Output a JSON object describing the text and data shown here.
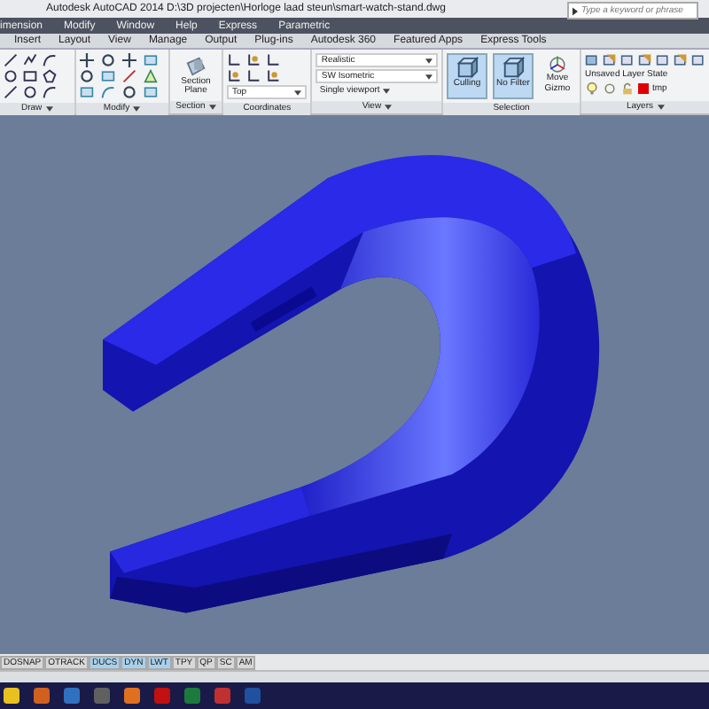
{
  "window": {
    "title": "Autodesk AutoCAD 2014    D:\\3D projecten\\Horloge laad steun\\smart-watch-stand.dwg"
  },
  "search": {
    "placeholder": "Type a keyword or phrase"
  },
  "menu": [
    "imension",
    "Modify",
    "Window",
    "Help",
    "Express",
    "Parametric"
  ],
  "ribbon_tabs": [
    "Insert",
    "Layout",
    "View",
    "Manage",
    "Output",
    "Plug-ins",
    "Autodesk 360",
    "Featured Apps",
    "Express Tools"
  ],
  "panels": {
    "draw": {
      "title": "Draw"
    },
    "modify": {
      "title": "Modify"
    },
    "section": {
      "title": "Section",
      "button": "Section Plane"
    },
    "coordinates": {
      "title": "Coordinates",
      "view_dropdown": "Top"
    },
    "view": {
      "title": "View",
      "visual_style": "Realistic",
      "view_preset": "SW Isometric",
      "viewport": "Single viewport"
    },
    "selection": {
      "title": "Selection",
      "buttons": [
        {
          "label": "Culling",
          "on": true
        },
        {
          "label": "No Filter",
          "on": true
        },
        {
          "label": "Move Gizmo",
          "on": false
        }
      ]
    },
    "layers": {
      "title": "Layers",
      "layer_state": "Unsaved Layer State",
      "layer": {
        "name": "tmp",
        "color": "#e00000"
      }
    }
  },
  "status_toggles": [
    {
      "label": "DOSNAP",
      "on": false
    },
    {
      "label": "OTRACK",
      "on": false
    },
    {
      "label": "DUCS",
      "on": true
    },
    {
      "label": "DYN",
      "on": true
    },
    {
      "label": "LWT",
      "on": true
    },
    {
      "label": "TPY",
      "on": false
    },
    {
      "label": "QP",
      "on": false
    },
    {
      "label": "SC",
      "on": false
    },
    {
      "label": "AM",
      "on": false
    }
  ]
}
